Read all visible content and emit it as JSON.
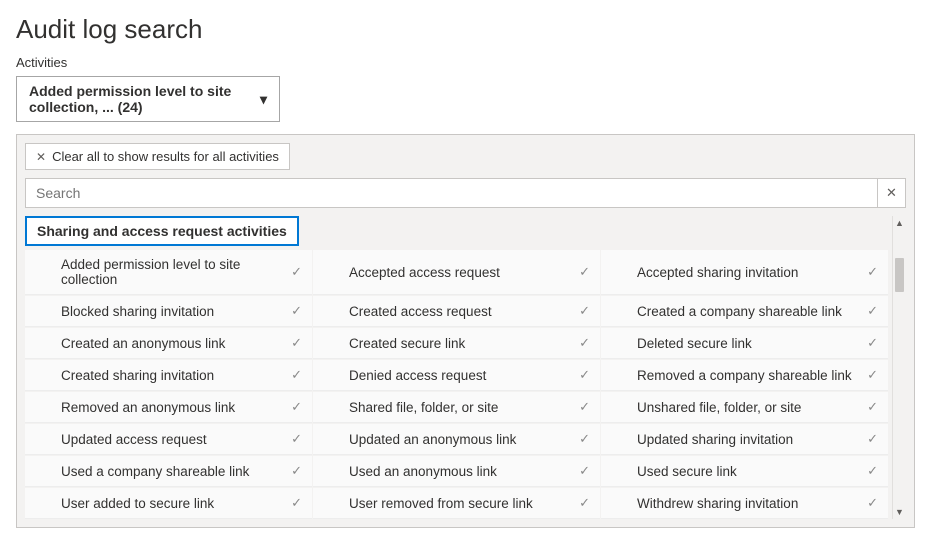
{
  "page_title": "Audit log search",
  "field_label": "Activities",
  "dropdown": {
    "selected_text": "Added permission level to site collection, ... (24)"
  },
  "panel": {
    "clear_label": "Clear all to show results for all activities",
    "search_placeholder": "Search",
    "category_label": "Sharing and access request activities",
    "rows": [
      {
        "c0": "Added permission level to site collection",
        "c1": "Accepted access request",
        "c2": "Accepted sharing invitation"
      },
      {
        "c0": "Blocked sharing invitation",
        "c1": "Created access request",
        "c2": "Created a company shareable link"
      },
      {
        "c0": "Created an anonymous link",
        "c1": "Created secure link",
        "c2": "Deleted secure link"
      },
      {
        "c0": "Created sharing invitation",
        "c1": "Denied access request",
        "c2": "Removed a company shareable link"
      },
      {
        "c0": "Removed an anonymous link",
        "c1": "Shared file, folder, or site",
        "c2": "Unshared file, folder, or site"
      },
      {
        "c0": "Updated access request",
        "c1": "Updated an anonymous link",
        "c2": "Updated sharing invitation"
      },
      {
        "c0": "Used a company shareable link",
        "c1": "Used an anonymous link",
        "c2": "Used secure link"
      },
      {
        "c0": "User added to secure link",
        "c1": "User removed from secure link",
        "c2": "Withdrew sharing invitation"
      }
    ]
  }
}
